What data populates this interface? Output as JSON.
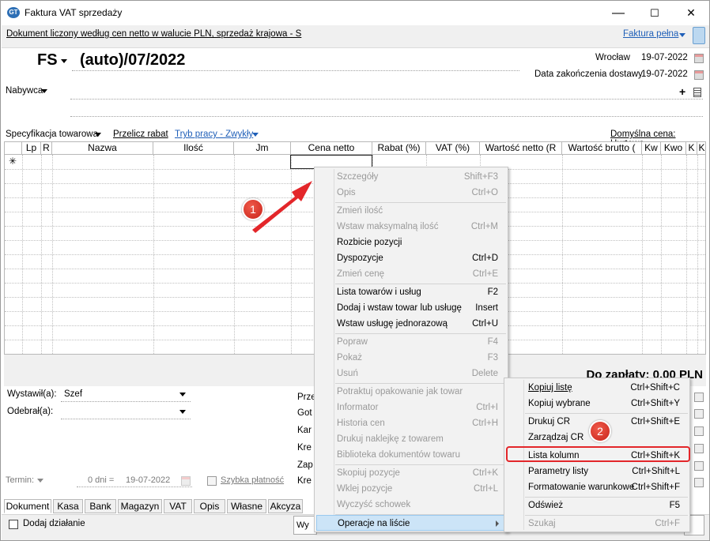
{
  "window": {
    "title": "Faktura VAT sprzedaży",
    "minimize": "—",
    "maximize": "☐",
    "close": "✕"
  },
  "infobar": {
    "text": "Dokument liczony według cen netto w walucie PLN, sprzedaż krajowa - S",
    "link": "Faktura pełna"
  },
  "header": {
    "doc_type": "FS",
    "doc_number": "(auto)/07/2022",
    "place": "Wrocław",
    "place_date": "19-07-2022",
    "delivery_label": "Data zakończenia dostawy",
    "delivery_date": "19-07-2022",
    "buyer_label": "Nabywca",
    "add_symbol": "+"
  },
  "toolbar": {
    "spec": "Specyfikacja towarowa",
    "recalc": "Przelicz rabat",
    "work_mode": "Tryb pracy - Zwykły",
    "default_price": "Domyślna cena: Hurtowa"
  },
  "grid": {
    "columns": [
      "",
      "Lp",
      "R",
      "Nazwa",
      "Ilość",
      "Jm",
      "Cena netto",
      "Rabat (%)",
      "VAT (%)",
      "Wartość netto (R",
      "Wartość brutto (",
      "Kw",
      "Kwo",
      "K",
      "K"
    ],
    "new_row_marker": "✳"
  },
  "totals": {
    "label": "Do zapłaty: 0,00 PLN"
  },
  "bottom": {
    "issued_label": "Wystawił(a):",
    "issued_value": "Szef",
    "received_label": "Odebrał(a):",
    "received_value": "",
    "term_label": "Termin:",
    "term_days": "0 dni =",
    "term_date": "19-07-2022",
    "quick_pay": "Szybka płatność",
    "payment_labels": [
      "Prze",
      "Got",
      "Kar",
      "Kre",
      "Zap",
      "Kre"
    ],
    "add_action": "Dodaj działanie",
    "print_btn": "Wy"
  },
  "tabs": [
    "Dokument",
    "Kasa",
    "Bank",
    "Magazyn",
    "VAT",
    "Opis",
    "Własne",
    "Akcyza"
  ],
  "context_menu": {
    "items": [
      {
        "label": "Szczegóły",
        "shortcut": "Shift+F3",
        "disabled": true
      },
      {
        "label": "Opis",
        "shortcut": "Ctrl+O",
        "disabled": true
      },
      {
        "label": "Zmień ilość",
        "shortcut": "",
        "disabled": true
      },
      {
        "label": "Wstaw maksymalną ilość",
        "shortcut": "Ctrl+M",
        "disabled": true
      },
      {
        "label": "Rozbicie pozycji",
        "shortcut": "",
        "disabled": false
      },
      {
        "label": "Dyspozycje",
        "shortcut": "Ctrl+D",
        "disabled": false
      },
      {
        "label": "Zmień cenę",
        "shortcut": "Ctrl+E",
        "disabled": true
      },
      {
        "label": "Lista towarów i usług",
        "shortcut": "F2",
        "disabled": false
      },
      {
        "label": "Dodaj i wstaw towar lub usługę",
        "shortcut": "Insert",
        "disabled": false
      },
      {
        "label": "Wstaw usługę jednorazową",
        "shortcut": "Ctrl+U",
        "disabled": false
      },
      {
        "label": "Popraw",
        "shortcut": "F4",
        "disabled": true
      },
      {
        "label": "Pokaż",
        "shortcut": "F3",
        "disabled": true
      },
      {
        "label": "Usuń",
        "shortcut": "Delete",
        "disabled": true
      },
      {
        "label": "Potraktuj opakowanie jak towar",
        "shortcut": "",
        "disabled": true
      },
      {
        "label": "Informator",
        "shortcut": "Ctrl+I",
        "disabled": true
      },
      {
        "label": "Historia cen",
        "shortcut": "Ctrl+H",
        "disabled": true
      },
      {
        "label": "Drukuj naklejkę z towarem",
        "shortcut": "",
        "disabled": true
      },
      {
        "label": "Biblioteka dokumentów towaru",
        "shortcut": "",
        "disabled": true
      },
      {
        "label": "Skopiuj pozycje",
        "shortcut": "Ctrl+K",
        "disabled": true
      },
      {
        "label": "Wklej pozycje",
        "shortcut": "Ctrl+L",
        "disabled": true
      },
      {
        "label": "Wyczyść schowek",
        "shortcut": "",
        "disabled": true
      },
      {
        "label": "Operacje na liście",
        "shortcut": "",
        "disabled": false
      }
    ]
  },
  "submenu": {
    "items": [
      {
        "label": "Kopiuj listę",
        "shortcut": "Ctrl+Shift+C",
        "disabled": false
      },
      {
        "label": "Kopiuj wybrane",
        "shortcut": "Ctrl+Shift+Y",
        "disabled": false
      },
      {
        "label": "Drukuj CR",
        "shortcut": "Ctrl+Shift+E",
        "disabled": false
      },
      {
        "label": "Zarządzaj CR",
        "shortcut": "",
        "disabled": false
      },
      {
        "label": "Lista kolumn",
        "shortcut": "Ctrl+Shift+K",
        "disabled": false
      },
      {
        "label": "Parametry listy",
        "shortcut": "Ctrl+Shift+L",
        "disabled": false
      },
      {
        "label": "Formatowanie warunkowe",
        "shortcut": "Ctrl+Shift+F",
        "disabled": false
      },
      {
        "label": "Odśwież",
        "shortcut": "F5",
        "disabled": false
      },
      {
        "label": "Szukaj",
        "shortcut": "Ctrl+F",
        "disabled": true
      }
    ]
  },
  "annotations": {
    "badge1": "1",
    "badge2": "2"
  },
  "colors": {
    "link": "#1f5fb8",
    "highlight": "#cce4f7",
    "annotation": "#e3262a"
  }
}
